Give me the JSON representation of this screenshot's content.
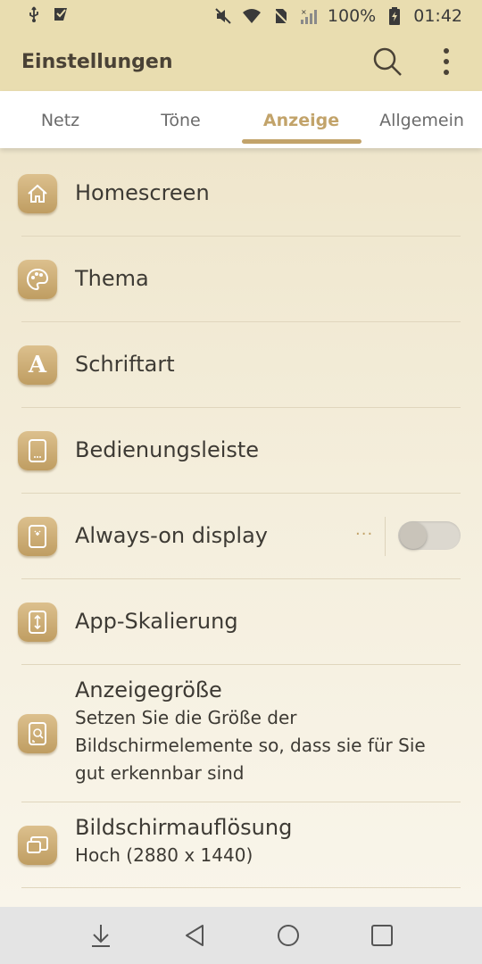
{
  "status_bar": {
    "battery_text": "100%",
    "time": "01:42",
    "left_icons": [
      "usb-icon",
      "download-check-icon"
    ],
    "right_icons": [
      "mute-icon",
      "wifi-icon",
      "no-sim-icon",
      "signal-icon",
      "battery-charging-icon"
    ]
  },
  "app_bar": {
    "title": "Einstellungen",
    "icons": [
      "search-icon",
      "more-vert-icon"
    ]
  },
  "tabs": [
    {
      "label": "Netz",
      "active": false
    },
    {
      "label": "Töne",
      "active": false
    },
    {
      "label": "Anzeige",
      "active": true
    },
    {
      "label": "Allgemein",
      "active": false
    }
  ],
  "settings": {
    "items": [
      {
        "title": "Homescreen",
        "icon": "home-icon"
      },
      {
        "title": "Thema",
        "icon": "palette-icon"
      },
      {
        "title": "Schriftart",
        "icon": "font-icon"
      },
      {
        "title": "Bedienungsleiste",
        "icon": "phone-nav-icon"
      },
      {
        "title": "Always-on display",
        "icon": "aod-icon",
        "more_label": "···",
        "toggle_on": false
      },
      {
        "title": "App-Skalierung",
        "icon": "app-scaling-icon"
      },
      {
        "title": "Anzeigegröße",
        "subtitle": "Setzen Sie die Größe der Bildschirmelemente so, dass sie für Sie gut erkennbar sind",
        "icon": "display-size-icon"
      },
      {
        "title": "Bildschirmauflösung",
        "subtitle": "Hoch (2880 x 1440)",
        "icon": "resolution-icon"
      }
    ]
  },
  "nav_bar": {
    "buttons": [
      "notification-pull-icon",
      "back-icon",
      "home-circle-icon",
      "recents-icon"
    ]
  },
  "colors": {
    "accent": "#c2a36a",
    "header_bg": "#e9ddb0",
    "icon_bg": "#c9a96f"
  }
}
